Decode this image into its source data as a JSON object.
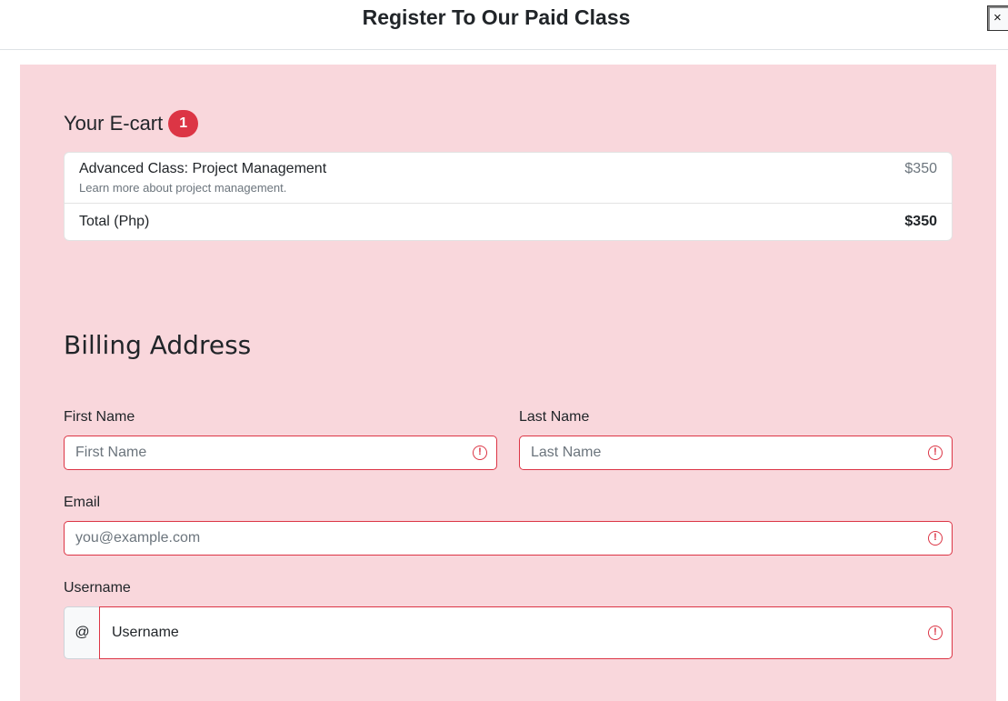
{
  "header": {
    "title": "Register To Our Paid Class",
    "close_label": "×"
  },
  "cart": {
    "heading": "Your E-cart",
    "badge_count": "1",
    "items": [
      {
        "name": "Advanced Class: Project Management",
        "description": "Learn more about project management.",
        "price": "$350"
      }
    ],
    "total_label": "Total (Php)",
    "total_value": "$350"
  },
  "billing": {
    "heading": "Billing Address",
    "first_name": {
      "label": "First Name",
      "placeholder": "First Name"
    },
    "last_name": {
      "label": "Last Name",
      "placeholder": "Last Name"
    },
    "email": {
      "label": "Email",
      "placeholder": "you@example.com"
    },
    "username": {
      "label": "Username",
      "prefix": "@",
      "placeholder": "Username"
    }
  },
  "colors": {
    "panel_bg": "#f9d7dc",
    "error": "#dc3545",
    "badge": "#dc3545"
  },
  "icons": {
    "error": "exclamation-circle-icon",
    "close": "close-icon"
  }
}
